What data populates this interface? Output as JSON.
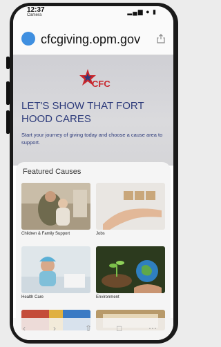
{
  "status": {
    "time": "12:37",
    "camera_label": "Camera",
    "signal": "▂▄▆ ● ▮"
  },
  "browser": {
    "url": "cfcgiving.opm.gov"
  },
  "hero": {
    "logo_text": "CFC",
    "title": "LET'S SHOW THAT FORT HOOD CARES",
    "subtitle": "Start your journey of giving today and choose a cause area to support."
  },
  "featured": {
    "heading": "Featured Causes",
    "cards": [
      {
        "label": "Children & Family Support"
      },
      {
        "label": "Jobs"
      },
      {
        "label": "Health Care"
      },
      {
        "label": "Environment"
      }
    ]
  },
  "colors": {
    "brand_red": "#c8262c",
    "brand_navy": "#2c3a7a",
    "url_dot": "#3f8fe0"
  }
}
